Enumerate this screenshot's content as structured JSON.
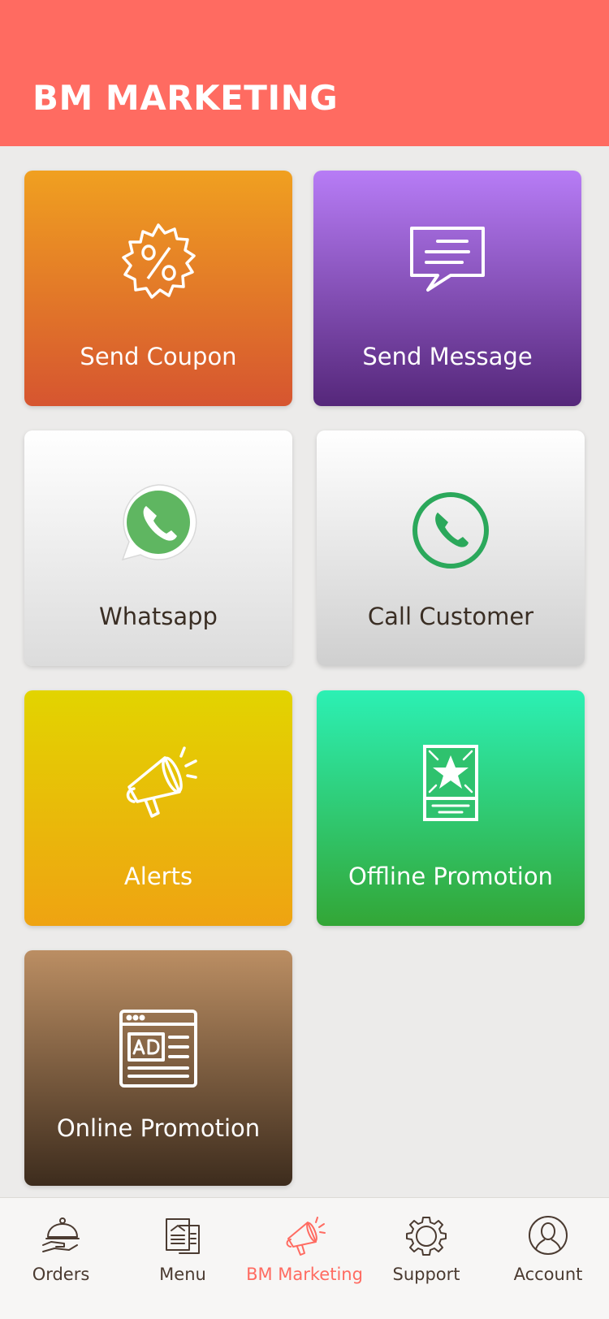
{
  "header": {
    "title": "BM MARKETING"
  },
  "tiles": [
    {
      "label": "Send Coupon",
      "icon": "coupon-badge-icon"
    },
    {
      "label": "Send Message",
      "icon": "message-bubble-icon"
    },
    {
      "label": "Whatsapp",
      "icon": "whatsapp-icon"
    },
    {
      "label": "Call Customer",
      "icon": "phone-icon"
    },
    {
      "label": "Alerts",
      "icon": "megaphone-icon"
    },
    {
      "label": "Offline Promotion",
      "icon": "star-poster-icon"
    },
    {
      "label": "Online Promotion",
      "icon": "ad-browser-icon"
    }
  ],
  "bottom_nav": {
    "active": "BM Marketing",
    "items": [
      {
        "label": "Orders",
        "icon": "cloche-icon"
      },
      {
        "label": "Menu",
        "icon": "menu-book-icon"
      },
      {
        "label": "BM Marketing",
        "icon": "megaphone-icon"
      },
      {
        "label": "Support",
        "icon": "gear-icon"
      },
      {
        "label": "Account",
        "icon": "user-icon"
      }
    ]
  },
  "colors": {
    "header": "#ff6b61",
    "active_nav": "#ff6b61",
    "nav_text": "#4b3b31",
    "background": "#ecebea"
  }
}
